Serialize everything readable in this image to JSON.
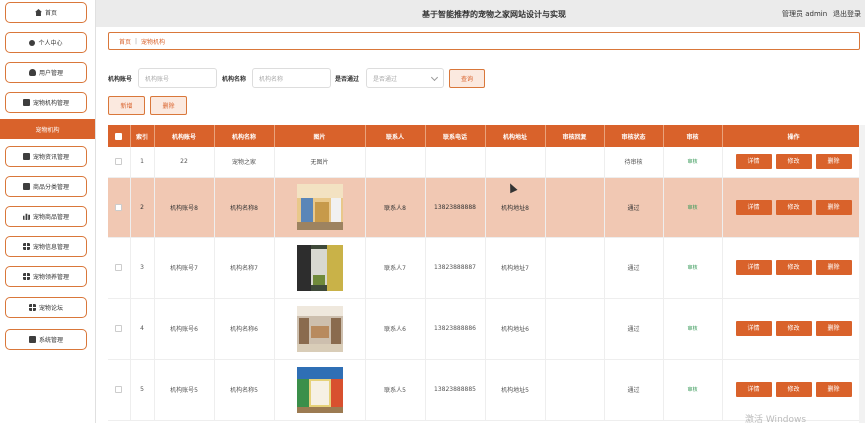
{
  "header": {
    "title": "基于智能推荐的宠物之家网站设计与实现",
    "admin": "管理员 admin",
    "logout": "退出登录"
  },
  "sidebar": {
    "items": [
      {
        "label": "首页",
        "icon": "home-icon"
      },
      {
        "label": "个人中心",
        "icon": "user-icon"
      },
      {
        "label": "用户管理",
        "icon": "users-icon"
      },
      {
        "label": "宠物机构管理",
        "icon": "building-icon"
      },
      {
        "label": "宠物资讯管理",
        "icon": "news-icon"
      },
      {
        "label": "商品分类管理",
        "icon": "category-icon"
      },
      {
        "label": "宠物商品管理",
        "icon": "chart-icon"
      },
      {
        "label": "宠物信息管理",
        "icon": "grid-icon"
      },
      {
        "label": "宠物领养管理",
        "icon": "grid-icon"
      },
      {
        "label": "宠物论坛",
        "icon": "grid-icon"
      },
      {
        "label": "系统管理",
        "icon": "settings-icon"
      }
    ],
    "active_label": "宠物机构"
  },
  "breadcrumb": {
    "home": "首页",
    "sep": "|",
    "current": "宠物机构"
  },
  "search": {
    "account_label": "机构账号",
    "account_placeholder": "机构账号",
    "name_label": "机构名称",
    "name_placeholder": "机构名称",
    "pass_label": "是否通过",
    "pass_placeholder": "是否通过",
    "query_button": "查询"
  },
  "toolbar": {
    "add_button": "新增",
    "delete_button": "删除"
  },
  "table": {
    "headers": [
      "",
      "索引",
      "机构账号",
      "机构名称",
      "图片",
      "联系人",
      "联系电话",
      "机构地址",
      "审核回复",
      "审核状态",
      "审核",
      "操作"
    ],
    "rows": [
      {
        "index": "1",
        "account": "22",
        "name": "宠物之家",
        "image": "无图片",
        "contact": "",
        "phone": "",
        "address": "",
        "reply": "",
        "status": "待审核",
        "audit": "审核"
      },
      {
        "index": "2",
        "account": "机构账号8",
        "name": "机构名称8",
        "image": "",
        "contact": "联系人8",
        "phone": "13823888888",
        "address": "机构地址8",
        "reply": "",
        "status": "通过",
        "audit": "审核"
      },
      {
        "index": "3",
        "account": "机构账号7",
        "name": "机构名称7",
        "image": "",
        "contact": "联系人7",
        "phone": "13823888887",
        "address": "机构地址7",
        "reply": "",
        "status": "通过",
        "audit": "审核"
      },
      {
        "index": "4",
        "account": "机构账号6",
        "name": "机构名称6",
        "image": "",
        "contact": "联系人6",
        "phone": "13823888886",
        "address": "机构地址6",
        "reply": "",
        "status": "通过",
        "audit": "审核"
      },
      {
        "index": "5",
        "account": "机构账号5",
        "name": "机构名称5",
        "image": "",
        "contact": "联系人5",
        "phone": "13823888885",
        "address": "机构地址5",
        "reply": "",
        "status": "通过",
        "audit": "审核"
      }
    ],
    "actions": {
      "detail": "详情",
      "edit": "修改",
      "delete": "删除"
    }
  },
  "watermark": "激活 Windows",
  "colors": {
    "accent": "#d9622b",
    "highlight_row": "#f1c8b3",
    "audit_link": "#3a9a5a"
  }
}
